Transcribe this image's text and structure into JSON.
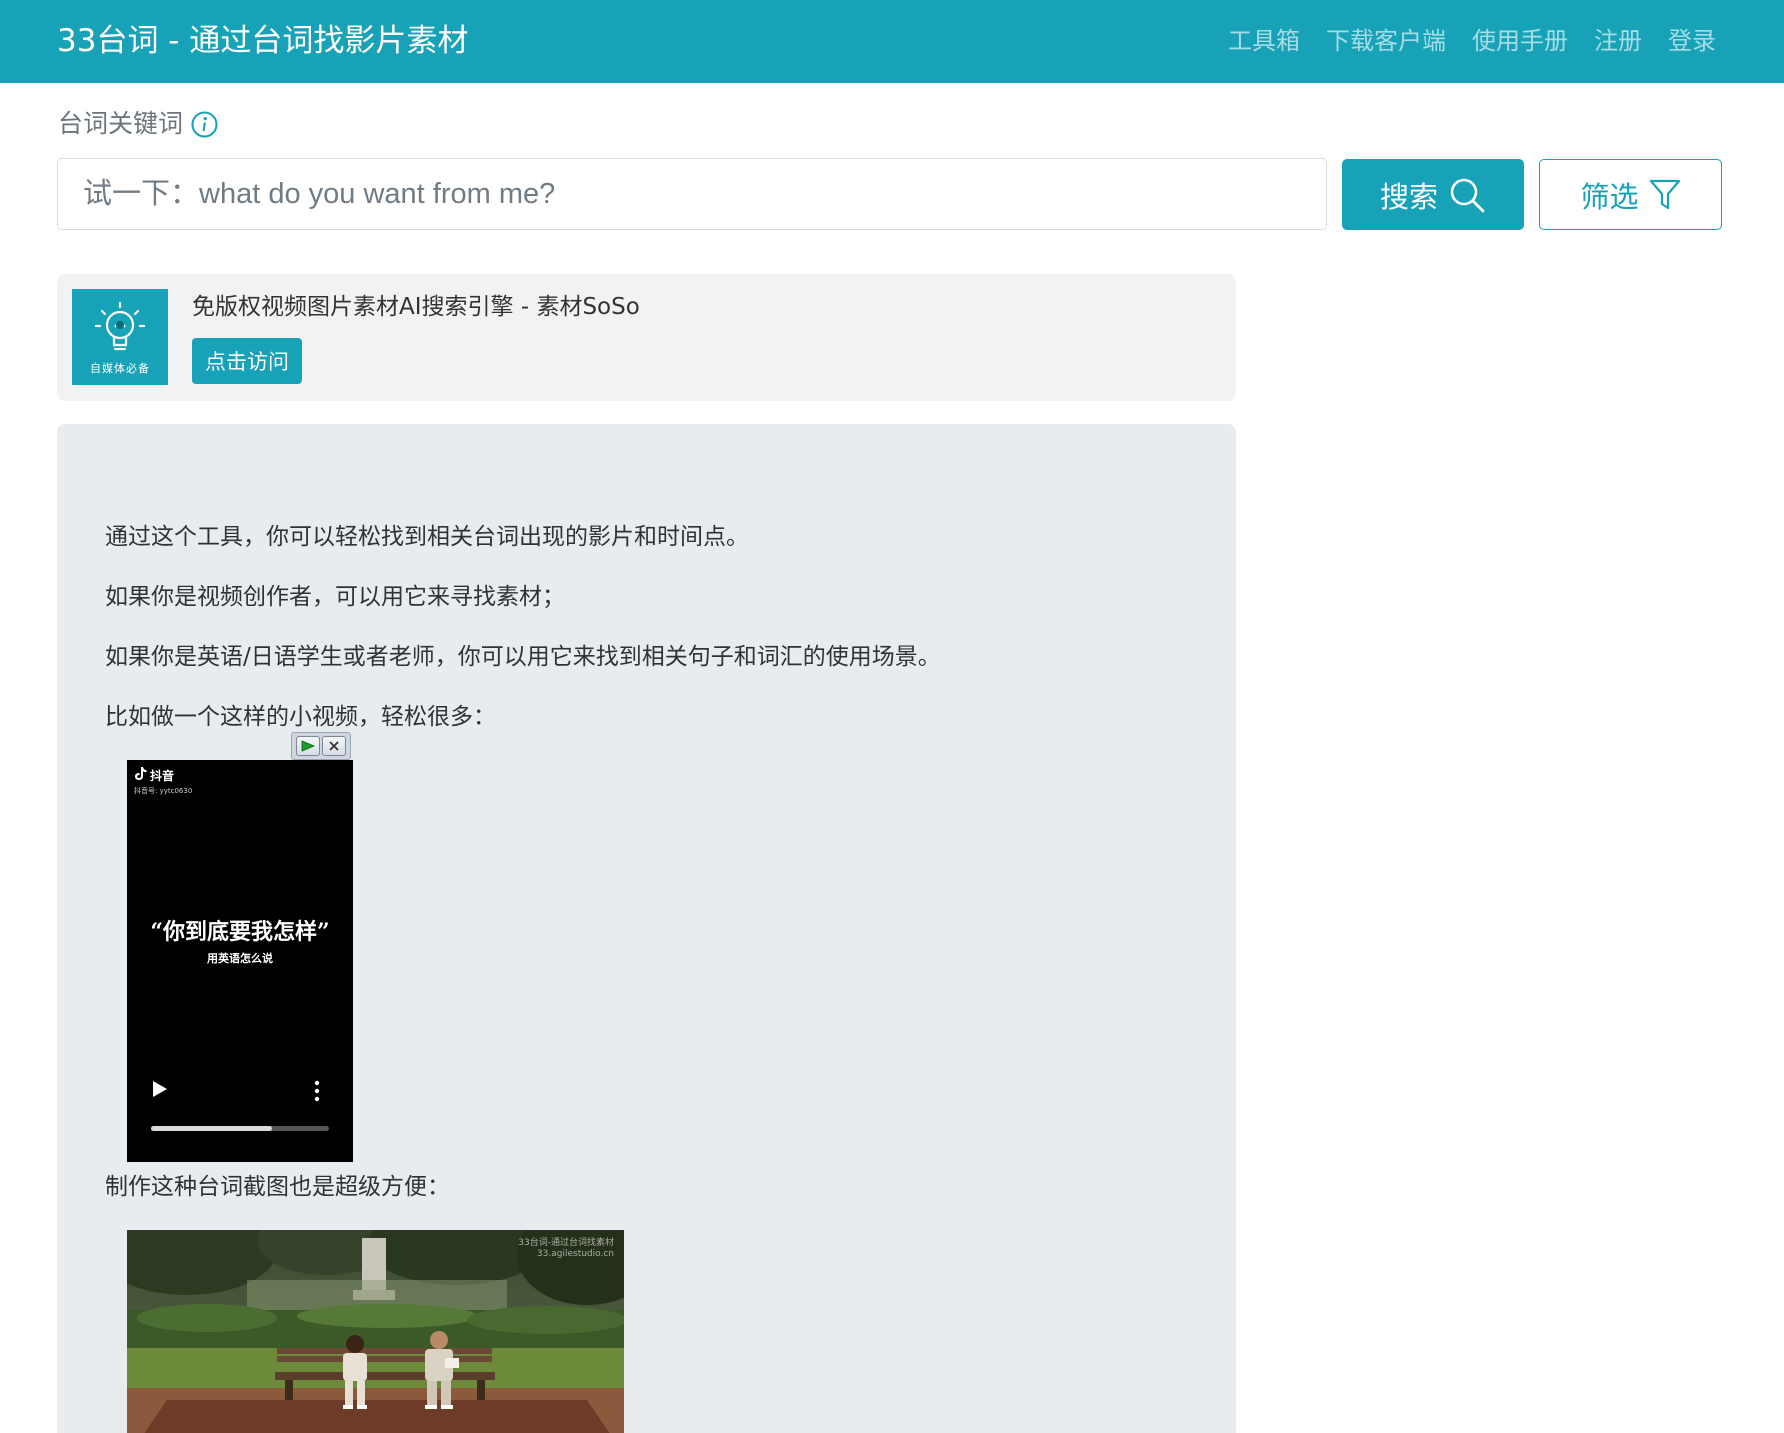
{
  "navbar": {
    "brand": "33台词 - 通过台词找影片素材",
    "links": [
      "工具箱",
      "下载客户端",
      "使用手册",
      "注册",
      "登录"
    ]
  },
  "search": {
    "label": "台词关键词",
    "placeholder": "试一下：what do you want from me?",
    "search_button": "搜索",
    "filter_button": "筛选"
  },
  "ad": {
    "logo_text": "自媒体必备",
    "title": "免版权视频图片素材AI搜索引擎 - 素材SoSo",
    "button": "点击访问"
  },
  "intro": {
    "paragraphs": [
      "通过这个工具，你可以轻松找到相关台词出现的影片和时间点。",
      "如果你是视频创作者，可以用它来寻找素材；",
      "如果你是英语/日语学生或者老师，你可以用它来找到相关句子和词汇的使用场景。",
      "比如做一个这样的小视频，轻松很多："
    ],
    "screenshot_caption": "制作这种台词截图也是超级方便："
  },
  "video": {
    "app_name": "抖音",
    "account": "抖音号: yytc0630",
    "title": "“你到底要我怎样”",
    "subtitle": "用英语怎么说",
    "progress": 0.68
  },
  "screenshot": {
    "watermark_line1": "33台词-通过台词找素材",
    "watermark_line2": "33.agilestudio.cn"
  },
  "colors": {
    "primary": "#17a2b8",
    "panel": "#e9ecef",
    "ad_bg": "#f1f2f3"
  }
}
